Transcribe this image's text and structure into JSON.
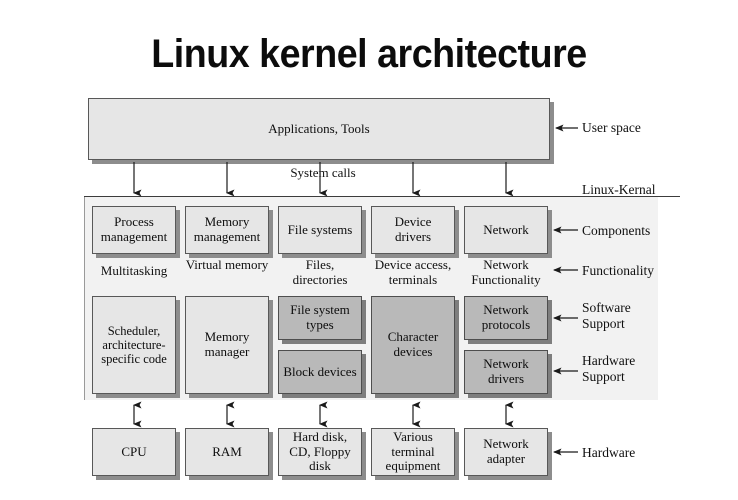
{
  "title": "Linux kernel architecture",
  "user_space": {
    "box_label": "Applications, Tools",
    "side_label": "User space"
  },
  "system_calls_label": "System calls",
  "kernel": {
    "side_label": "Linux-Kernal",
    "row_labels": {
      "components": "Components",
      "functionality": "Functionality",
      "software_support_line1": "Software",
      "software_support_line2": "Support",
      "hardware_support_line1": "Hardware",
      "hardware_support_line2": "Support"
    },
    "components": [
      "Process management",
      "Memory management",
      "File systems",
      "Device drivers",
      "Network"
    ],
    "functionality": [
      "Multitasking",
      "Virtual memory",
      "Files, directories",
      "Device access, terminals",
      "Network Functionality"
    ],
    "support": [
      {
        "label": "Scheduler, architecture-specific code",
        "span": "both",
        "shade": "light"
      },
      {
        "label": "Memory manager",
        "span": "both",
        "shade": "light"
      },
      {
        "label": "File system types",
        "span": "software",
        "shade": "dark"
      },
      {
        "label": "Block devices",
        "span": "hardware",
        "shade": "dark"
      },
      {
        "label": "Character devices",
        "span": "both",
        "shade": "dark"
      },
      {
        "label": "Network protocols",
        "span": "software",
        "shade": "dark"
      },
      {
        "label": "Network drivers",
        "span": "hardware",
        "shade": "dark"
      }
    ]
  },
  "hardware": {
    "side_label": "Hardware",
    "boxes": [
      "CPU",
      "RAM",
      "Hard disk, CD, Floppy disk",
      "Various terminal equipment",
      "Network adapter"
    ]
  },
  "colors": {
    "light_box": "#e6e6e6",
    "dark_box": "#b9b9b9",
    "panel": "#f2f2f2",
    "shadow": "#8d8d8d",
    "stroke": "#585858",
    "text": "#0d0d0d"
  }
}
